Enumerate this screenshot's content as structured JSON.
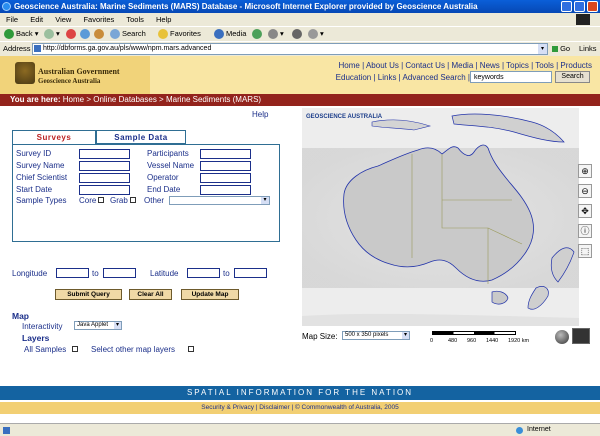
{
  "window": {
    "title": "Geoscience Australia: Marine Sediments (MARS) Database - Microsoft Internet Explorer provided by Geoscience Australia"
  },
  "menu": [
    "File",
    "Edit",
    "View",
    "Favorites",
    "Tools",
    "Help"
  ],
  "toolbar": {
    "back": "Back",
    "search": "Search",
    "favorites": "Favorites",
    "media": "Media"
  },
  "address": {
    "label": "Address",
    "url": "http://dbforms.ga.gov.au/pls/www/npm.mars.advanced",
    "go": "Go",
    "links": "Links"
  },
  "header": {
    "gov_line1": "Australian Government",
    "gov_line2": "Geoscience Australia",
    "nav1": "Home | About Us | Contact Us | Media | News | Topics | Tools | Products",
    "nav2": "Education | Links | Advanced Search |",
    "search_placeholder": "keywords",
    "search_button": "Search"
  },
  "breadcrumb": {
    "prefix": "You are here:",
    "path": "Home > Online Databases > Marine Sediments (MARS)"
  },
  "help": "Help",
  "tabs": {
    "surveys": "Surveys",
    "sample_data": "Sample Data"
  },
  "form": {
    "survey_id": "Survey ID",
    "survey_name": "Survey Name",
    "chief_scientist": "Chief Scientist",
    "start_date": "Start Date",
    "sample_types": "Sample Types",
    "core": "Core",
    "grab": "Grab",
    "participants": "Participants",
    "vessel_name": "Vessel Name",
    "operator": "Operator",
    "end_date": "End Date",
    "other": "Other"
  },
  "coords": {
    "longitude": "Longitude",
    "latitude": "Latitude",
    "to": "to"
  },
  "buttons": {
    "submit": "Submit Query",
    "clear": "Clear All",
    "update": "Update Map"
  },
  "map_section": {
    "title": "Map",
    "interactivity_label": "Interactivity",
    "interactivity_value": "Java Applet",
    "layers": "Layers",
    "all_samples": "All Samples",
    "select_layers": "Select other map layers",
    "map_size_label": "Map Size:",
    "map_size_value": "500 x 350 pixels",
    "scale_labels": [
      "0",
      "480",
      "960",
      "1440",
      "1920 km"
    ],
    "logo_text": "GEOSCIENCE AUSTRALIA"
  },
  "footer": {
    "tagline": "SPATIAL INFORMATION FOR THE NATION",
    "links": "Security & Privacy | Disclaimer | © Commonwealth of Australia, 2005"
  },
  "status": {
    "zone": "Internet"
  },
  "colors": {
    "link": "#1b2f8a",
    "breadcrumb_bg": "#93231c",
    "footer_blue": "#1463a1",
    "footer_yellow": "#f2cf73"
  }
}
